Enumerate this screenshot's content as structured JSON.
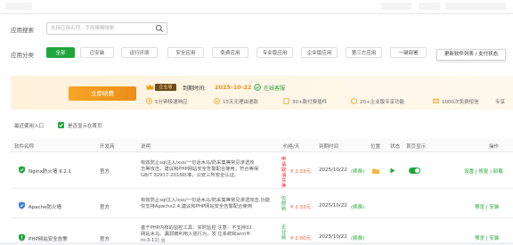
{
  "search": {
    "label": "应用搜索",
    "placeholder": "支持应用名称、字段模糊搜索"
  },
  "categories": {
    "label": "应用分类",
    "items": [
      "全部",
      "已安装",
      "运行环境",
      "安全应用",
      "免费应用",
      "专业版应用",
      "企业版应用",
      "第三方应用",
      "一键部署"
    ],
    "active": 0
  },
  "tooltip": "更新软件列表 / 支付状态",
  "banner": {
    "buy_button": "立即续费",
    "badge": "企业版",
    "expire_label": "到期时间:",
    "expire_date": "2025-10-22",
    "renew_link": "在线客服",
    "features": [
      "5分钟极速响应",
      "15天无理由退款",
      "30+款付费插件",
      "20+企业版专享功能",
      "1000次免费短信",
      "专享"
    ]
  },
  "recent": {
    "label": "最近使用入口",
    "checkbox_label": "是否显示在首页"
  },
  "table": {
    "headers": [
      "软件名称",
      "开发商",
      "说明",
      "价格/天",
      "到期时间",
      "位置",
      "状态",
      "首页显示",
      "操作"
    ],
    "rows": [
      {
        "name": "Nginx防火墙 9.2.1",
        "vendor": "官方",
        "desc": [
          "有效防止sql注入/xss/一句话木马/防采集等常见渗透攻",
          "击等攻击，建议和PHP网站安全告警配合使用，符合等保",
          "GB/T 32917-2016标准，公安三所安全认证。"
        ],
        "warn": [
          "申",
          "请",
          "取",
          "消",
          "兑",
          "换"
        ],
        "price": "¥ 2.33元",
        "expire": "2025/10/22",
        "expire_note": "(续费)",
        "ops": "设置 | 修复 | 卸载",
        "color": "#20a53a"
      },
      {
        "name": "Apache防火墙",
        "vendor": "官方",
        "desc": [
          "有效防止sql注入/xss/一句话木马/防采集等常见渗透攻击,功能",
          "仅支持Apache2.4,建议和PHP网站安全告警配合使用"
        ],
        "tag": [
          "仅",
          "限",
          "购"
        ],
        "price": "¥ 2.33元",
        "expire": "2025/10/22",
        "expire_note": "(续费)",
        "ops": "预览 | 安装",
        "color": "#3a7bd5"
      },
      {
        "name": "PHP网站安全告警",
        "vendor": "官方",
        "desc": [
          "基于PHP内核的监控工具，实时监控 注意：不支持32",
          "网站木马、漏洞被利用入侵行为，发 位系统和arm平",
          "ni-3-11) 台"
        ],
        "tag": [
          "企",
          "业",
          "版"
        ],
        "price": "¥ 2.00元",
        "expire": "2025/10/22",
        "expire_note": "(续费)",
        "ops": "预览 | 安装",
        "color": "#20a53a"
      }
    ]
  }
}
